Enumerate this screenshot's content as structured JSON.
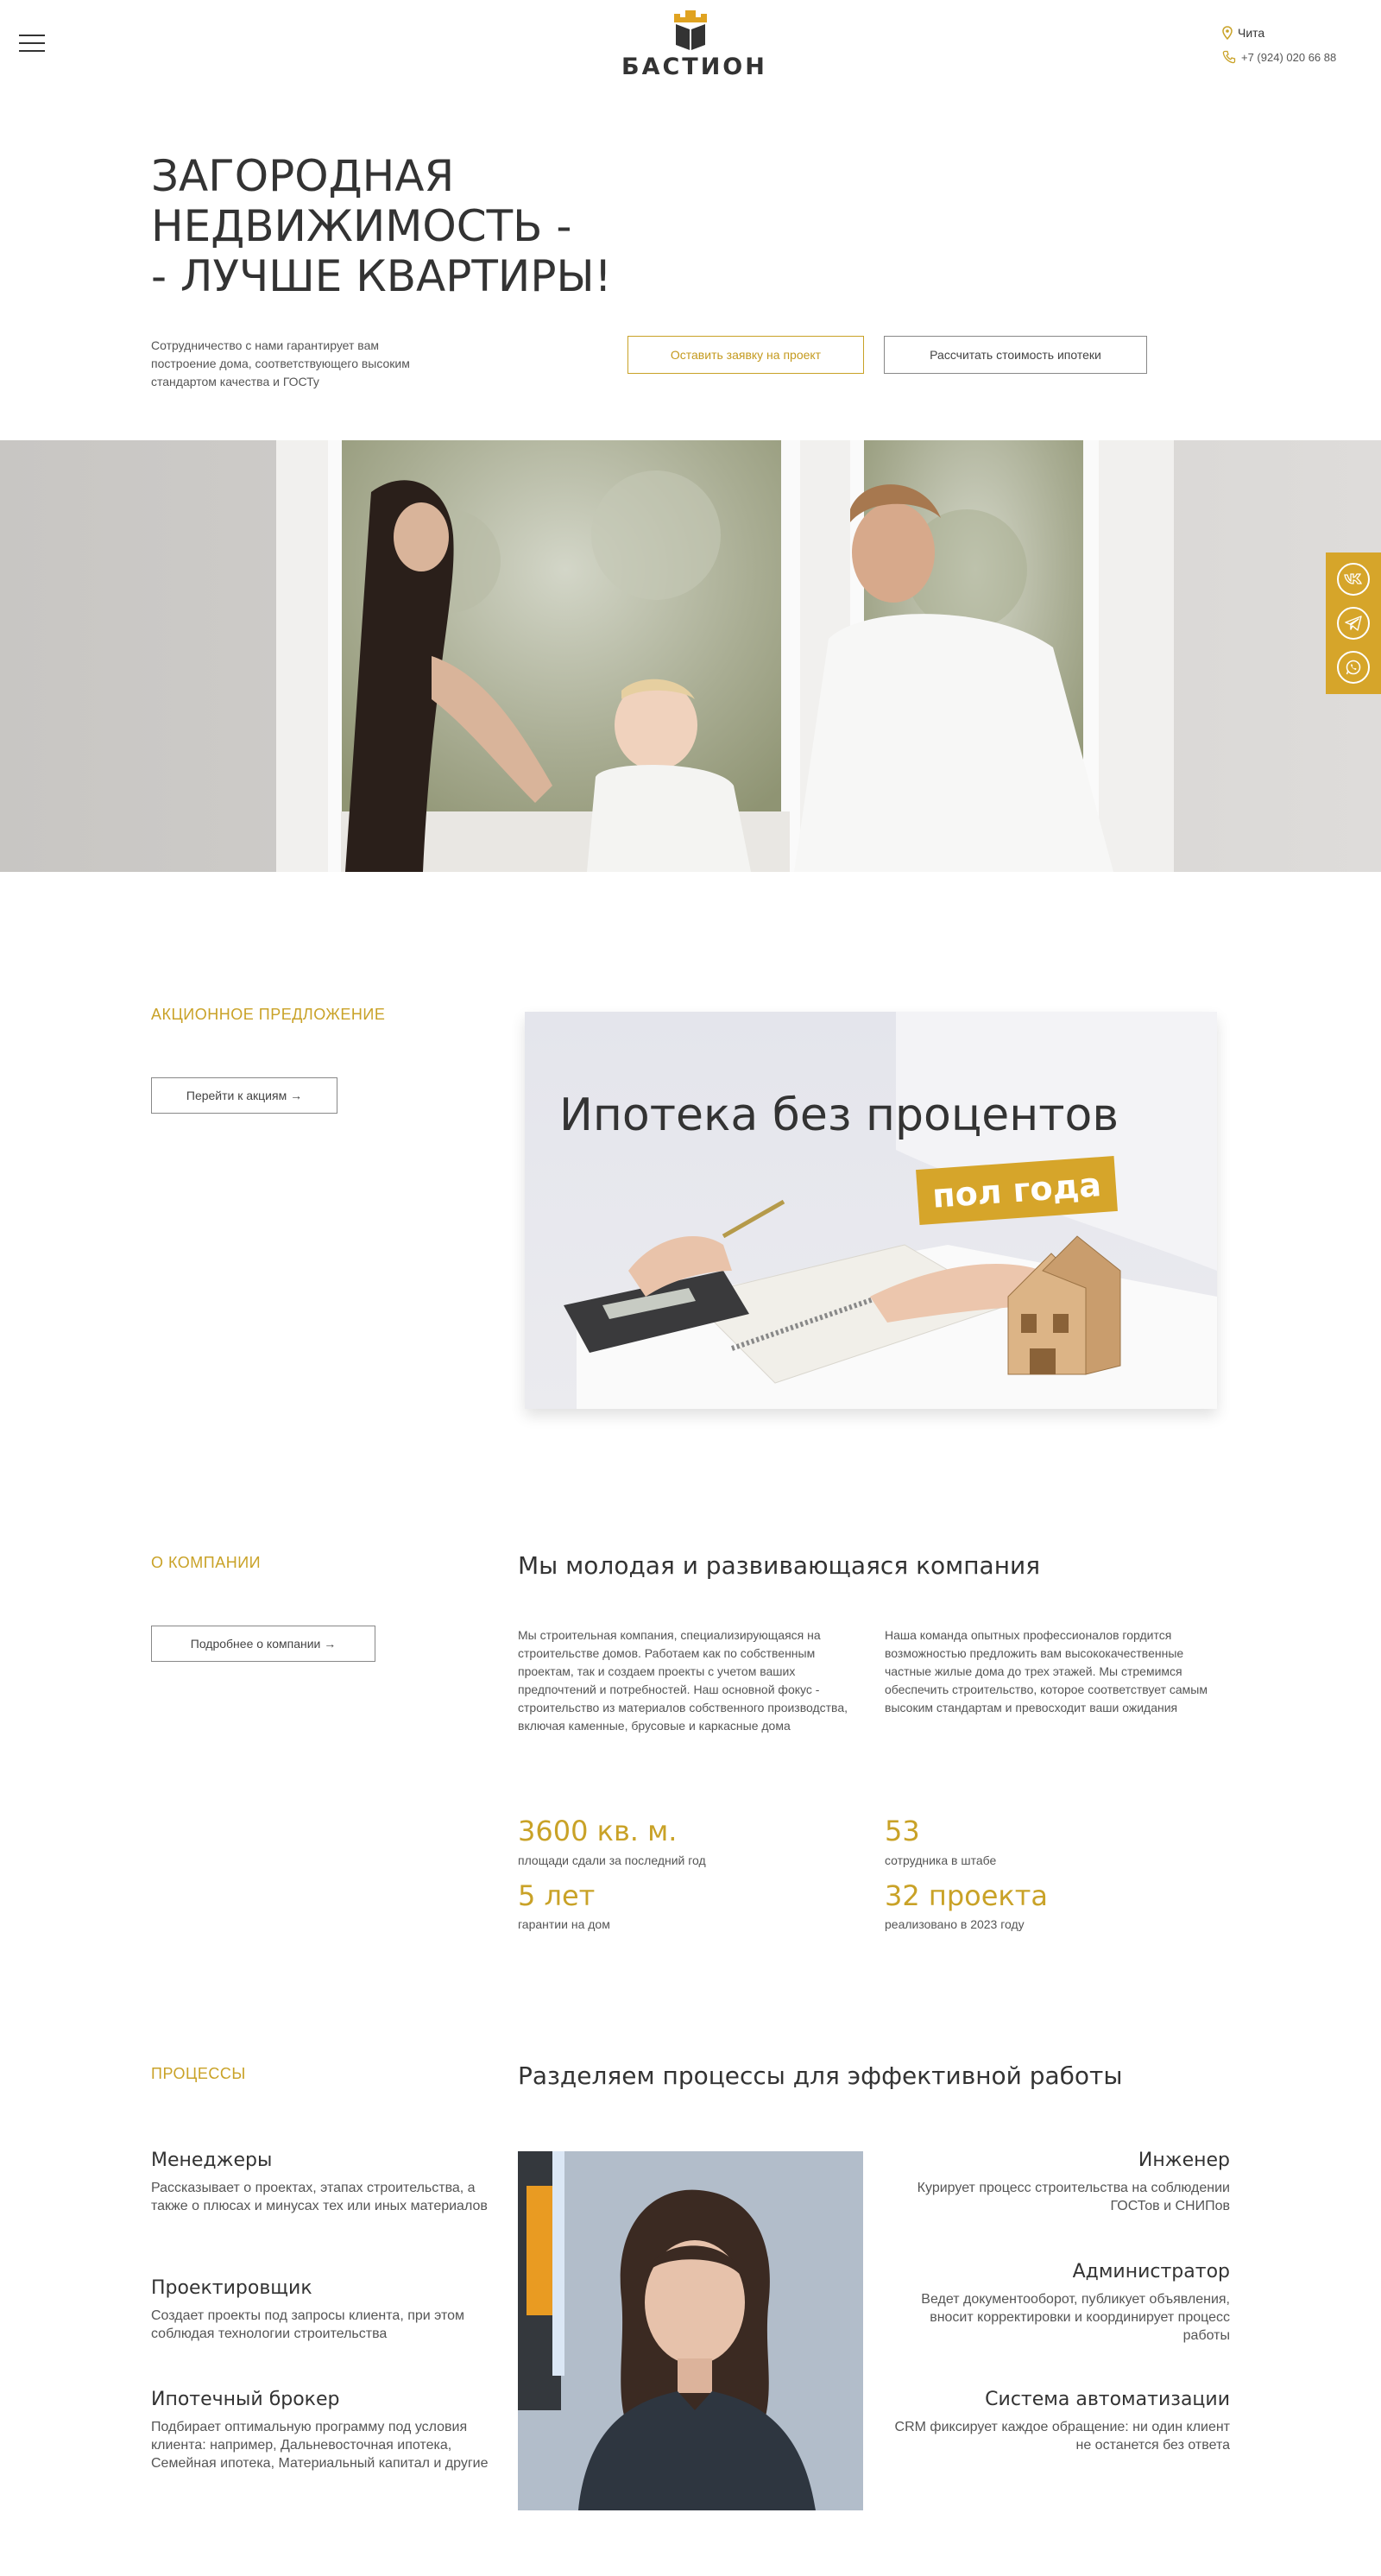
{
  "header": {
    "brand": "БАСТИОН",
    "city": "Чита",
    "phone": "+7 (924) 020 66 88"
  },
  "hero": {
    "title_lines": [
      "ЗАГОРОДНАЯ",
      "НЕДВИЖИМОСТЬ -",
      "- ЛУЧШЕ КВАРТИРЫ!"
    ],
    "subtitle": "Сотрудничество с нами гарантирует вам построение дома, соответствующего высоким стандартом качества и ГОСТу",
    "btn_request": "Оставить заявку на проект",
    "btn_mortgage": "Рассчитать стоимость ипотеки"
  },
  "promo": {
    "label": "АКЦИОННОЕ ПРЕДЛОЖЕНИЕ",
    "button": "Перейти к акциям →",
    "banner_title": "Ипотека без процентов",
    "banner_badge": "пол года"
  },
  "about": {
    "label": "О КОМПАНИИ",
    "button": "Подробнее о компании →",
    "heading": "Мы молодая и развивающаяся компания",
    "para1": "Мы строительная компания, специализирующаяся на строительстве домов. Работаем как по собственным проектам, так и создаем проекты с учетом ваших предпочтений и потребностей. Наш основной фокус - строительство из материалов собственного производства, включая каменные, брусовые и каркасные дома",
    "para2": "Наша команда опытных профессионалов гордится возможностью предложить вам высококачественные частные жилые дома до трех этажей. Мы стремимся обеспечить строительство, которое соответствует самым высоким стандартам и превосходит ваши ожидания",
    "stats": [
      {
        "value": "3600 кв. м.",
        "caption": "площади сдали за последний год"
      },
      {
        "value": "53",
        "caption": "сотрудника в штабе"
      },
      {
        "value": "5 лет",
        "caption": "гарантии на дом"
      },
      {
        "value": "32 проекта",
        "caption": "реализовано в 2023 году"
      }
    ]
  },
  "processes": {
    "label": "ПРОЦЕССЫ",
    "heading": "Разделяем процессы для эффективной работы",
    "left": [
      {
        "title": "Менеджеры",
        "text": "Рассказывает о проектах, этапах строительства, а также о плюсах и минусах тех или иных материалов"
      },
      {
        "title": "Проектировщик",
        "text": "Создает проекты под запросы клиента, при этом соблюдая технологии строительства"
      },
      {
        "title": "Ипотечный брокер",
        "text": "Подбирает оптимальную программу под условия клиента: например, Дальневосточная ипотека, Семейная ипотека, Материальный капитал и другие"
      }
    ],
    "right": [
      {
        "title": "Инженер",
        "text": "Курирует процесс строительства на соблюдении ГОСТов и СНИПов"
      },
      {
        "title": "Администратор",
        "text": "Ведет документооборот, публикует объявления, вносит корректировки и координирует процесс работы"
      },
      {
        "title": "Система автоматизации",
        "text": "CRM фиксирует каждое обращение: ни один клиент не останется без ответа"
      }
    ]
  },
  "colors": {
    "accent": "#c9a227",
    "social_bg": "#d6a52a",
    "text": "#333333"
  },
  "icons": [
    "menu-icon",
    "location-pin-icon",
    "phone-icon",
    "vk-icon",
    "telegram-icon",
    "whatsapp-icon"
  ]
}
